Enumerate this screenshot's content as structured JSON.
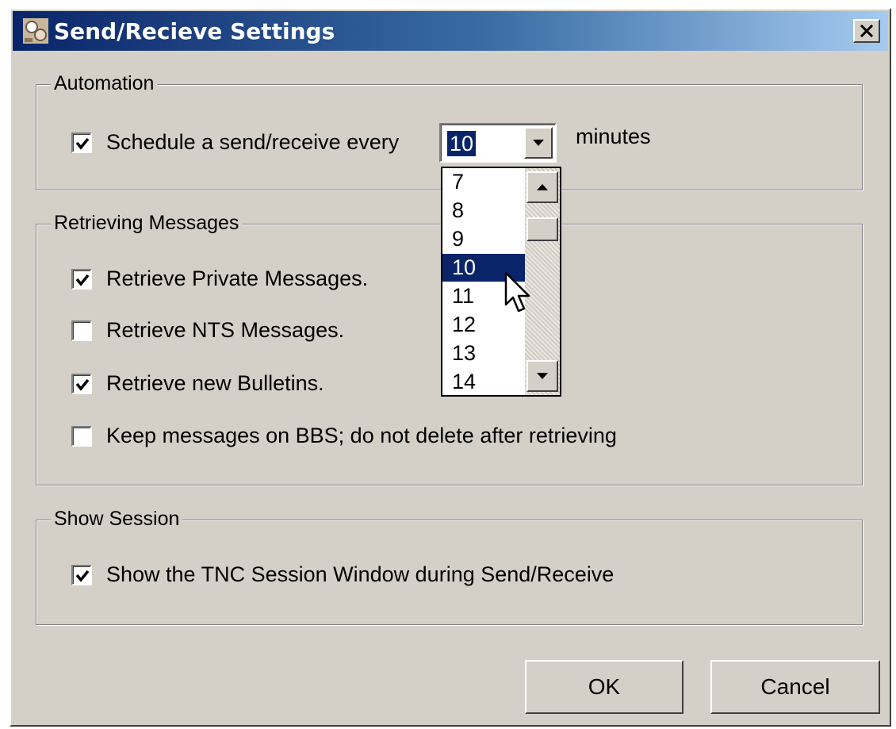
{
  "window": {
    "title": "Send/Recieve Settings",
    "close_glyph": "✕"
  },
  "automation": {
    "legend": "Automation",
    "schedule_label": "Schedule a send/receive every",
    "schedule_checked": true,
    "interval_value": "10",
    "interval_unit": "minutes",
    "dropdown_options": [
      "7",
      "8",
      "9",
      "10",
      "11",
      "12",
      "13",
      "14"
    ],
    "dropdown_selected": "10"
  },
  "retrieving": {
    "legend": "Retrieving Messages",
    "options": [
      {
        "label": "Retrieve Private Messages.",
        "checked": true
      },
      {
        "label": "Retrieve NTS Messages.",
        "checked": false
      },
      {
        "label": "Retrieve new Bulletins.",
        "checked": true
      },
      {
        "label": "Keep messages on BBS; do not delete after retrieving",
        "checked": false
      }
    ]
  },
  "session": {
    "legend": "Show Session",
    "show_label": "Show the TNC Session Window during Send/Receive",
    "show_checked": true
  },
  "buttons": {
    "ok": "OK",
    "cancel": "Cancel"
  },
  "colors": {
    "title_gradient_start": "#0a246a",
    "title_gradient_end": "#a6caf0",
    "face": "#d4d0c8",
    "selection": "#0a246a"
  },
  "icons": {
    "app": "settings-app-icon",
    "close": "close-icon",
    "check": "check-icon",
    "dropdown": "chevron-down-icon",
    "scroll_up": "arrow-up-icon",
    "scroll_down": "arrow-down-icon",
    "cursor": "mouse-pointer-icon"
  }
}
